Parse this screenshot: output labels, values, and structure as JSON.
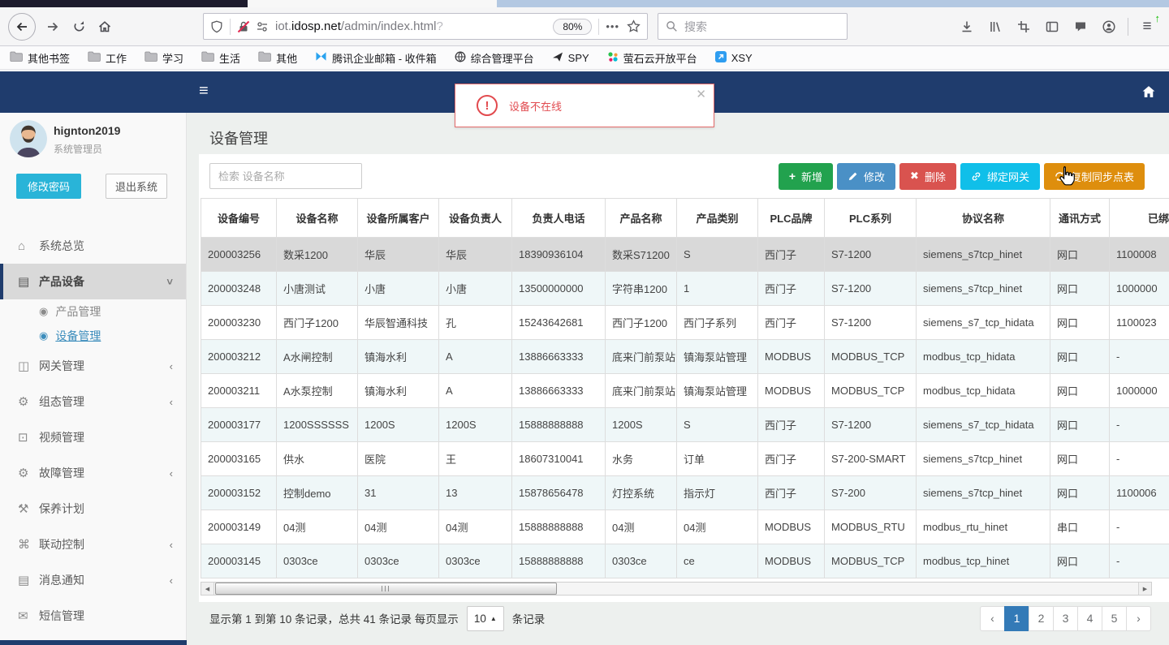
{
  "browser": {
    "url": {
      "prefix": "iot.",
      "domain": "idosp.net",
      "path": "/admin/index.html",
      "query": "?"
    },
    "zoom_badge": "80%",
    "search_placeholder": "搜索",
    "bookmark_folders": [
      "其他书签",
      "工作",
      "学习",
      "生活",
      "其他"
    ],
    "bookmark_links": [
      {
        "label": "腾讯企业邮箱 - 收件箱",
        "icon": "tencent-mail-icon"
      },
      {
        "label": "综合管理平台",
        "icon": "globe-icon"
      },
      {
        "label": "SPY",
        "icon": "plane-icon"
      },
      {
        "label": "萤石云开放平台",
        "icon": "ys7-icon"
      },
      {
        "label": "XSY",
        "icon": "xsy-icon"
      }
    ]
  },
  "alert": {
    "message": "设备不在线"
  },
  "sidebar": {
    "user": {
      "name": "hignton2019",
      "role": "系统管理员"
    },
    "change_password": "修改密码",
    "logout": "退出系统",
    "menu": [
      {
        "label": "系统总览",
        "icon": "home-icon",
        "chevron": ""
      },
      {
        "label": "产品设备",
        "icon": "book-icon",
        "chevron": "down",
        "active": true,
        "children": [
          {
            "label": "产品管理",
            "active": false
          },
          {
            "label": "设备管理",
            "active": true
          }
        ]
      },
      {
        "label": "网关管理",
        "icon": "video-icon",
        "chevron": "left"
      },
      {
        "label": "组态管理",
        "icon": "gears-icon",
        "chevron": "left"
      },
      {
        "label": "视频管理",
        "icon": "monitor-icon",
        "chevron": ""
      },
      {
        "label": "故障管理",
        "icon": "gears-icon",
        "chevron": "left"
      },
      {
        "label": "保养计划",
        "icon": "wrench-icon",
        "chevron": ""
      },
      {
        "label": "联动控制",
        "icon": "sitemap-icon",
        "chevron": "left"
      },
      {
        "label": "消息通知",
        "icon": "book-icon",
        "chevron": "left"
      },
      {
        "label": "短信管理",
        "icon": "envelope-icon",
        "chevron": ""
      }
    ]
  },
  "main": {
    "page_title": "设备管理",
    "search_placeholder": "检索 设备名称",
    "toolbar_buttons": [
      {
        "label": "新增",
        "icon": "plus-icon",
        "color": "#22a24e"
      },
      {
        "label": "修改",
        "icon": "pencil-icon",
        "color": "#4a90c6"
      },
      {
        "label": "删除",
        "icon": "x-icon",
        "color": "#d9534f"
      },
      {
        "label": "绑定网关",
        "icon": "link-icon",
        "color": "#10bfe9"
      },
      {
        "label": "复制同步点表",
        "icon": "sync-icon",
        "color": "#de8e0d"
      }
    ],
    "table": {
      "headers": [
        "设备编号",
        "设备名称",
        "设备所属客户",
        "设备负责人",
        "负责人电话",
        "产品名称",
        "产品类别",
        "PLC品牌",
        "PLC系列",
        "协议名称",
        "通讯方式",
        "已绑定网关"
      ],
      "selected_row_index": 0,
      "rows": [
        [
          "200003256",
          "数采1200",
          "华辰",
          "华辰",
          "18390936104",
          "数采S71200",
          "S",
          "西门子",
          "S7-1200",
          "siemens_s7tcp_hinet",
          "网口",
          "1100008"
        ],
        [
          "200003248",
          "小唐测试",
          "小唐",
          "小唐",
          "13500000000",
          "字符串1200",
          "1",
          "西门子",
          "S7-1200",
          "siemens_s7tcp_hinet",
          "网口",
          "1000000"
        ],
        [
          "200003230",
          "西门子1200",
          "华辰智通科技",
          "孔",
          "15243642681",
          "西门子1200",
          "西门子系列",
          "西门子",
          "S7-1200",
          "siemens_s7_tcp_hidata",
          "网口",
          "1100023"
        ],
        [
          "200003212",
          "A水闸控制",
          "镇海水利",
          "A",
          "13886663333",
          "底来门前泵站",
          "镇海泵站管理",
          "MODBUS",
          "MODBUS_TCP",
          "modbus_tcp_hidata",
          "网口",
          "-"
        ],
        [
          "200003211",
          "A水泵控制",
          "镇海水利",
          "A",
          "13886663333",
          "底来门前泵站",
          "镇海泵站管理",
          "MODBUS",
          "MODBUS_TCP",
          "modbus_tcp_hidata",
          "网口",
          "1000000"
        ],
        [
          "200003177",
          "1200SSSSSS",
          "1200S",
          "1200S",
          "15888888888",
          "1200S",
          "S",
          "西门子",
          "S7-1200",
          "siemens_s7_tcp_hidata",
          "网口",
          "-"
        ],
        [
          "200003165",
          "供水",
          "医院",
          "王",
          "18607310041",
          "水务",
          "订单",
          "西门子",
          "S7-200-SMART",
          "siemens_s7tcp_hinet",
          "网口",
          "-"
        ],
        [
          "200003152",
          "控制demo",
          "31",
          "13",
          "15878656478",
          "灯控系统",
          "指示灯",
          "西门子",
          "S7-200",
          "siemens_s7tcp_hinet",
          "网口",
          "1100006"
        ],
        [
          "200003149",
          "04测",
          "04测",
          "04测",
          "15888888888",
          "04测",
          "04测",
          "MODBUS",
          "MODBUS_RTU",
          "modbus_rtu_hinet",
          "串口",
          "-"
        ],
        [
          "200003145",
          "0303ce",
          "0303ce",
          "0303ce",
          "15888888888",
          "0303ce",
          "ce",
          "MODBUS",
          "MODBUS_TCP",
          "modbus_tcp_hinet",
          "网口",
          "-"
        ]
      ]
    },
    "pagination": {
      "summary_prefix": "显示第 1 到第 10 条记录，总共 41 条记录 每页显示",
      "page_size": "10",
      "summary_suffix": "条记录",
      "pages": [
        "1",
        "2",
        "3",
        "4",
        "5"
      ],
      "active_page": "1",
      "prev": "‹",
      "next": "›"
    }
  },
  "colors": {
    "navbar": "#1f3c6d",
    "active_link": "#3c8dbc",
    "alert": "#e14b50",
    "pagination_active": "#337ab7",
    "selected_row": "#d9d9d9"
  }
}
